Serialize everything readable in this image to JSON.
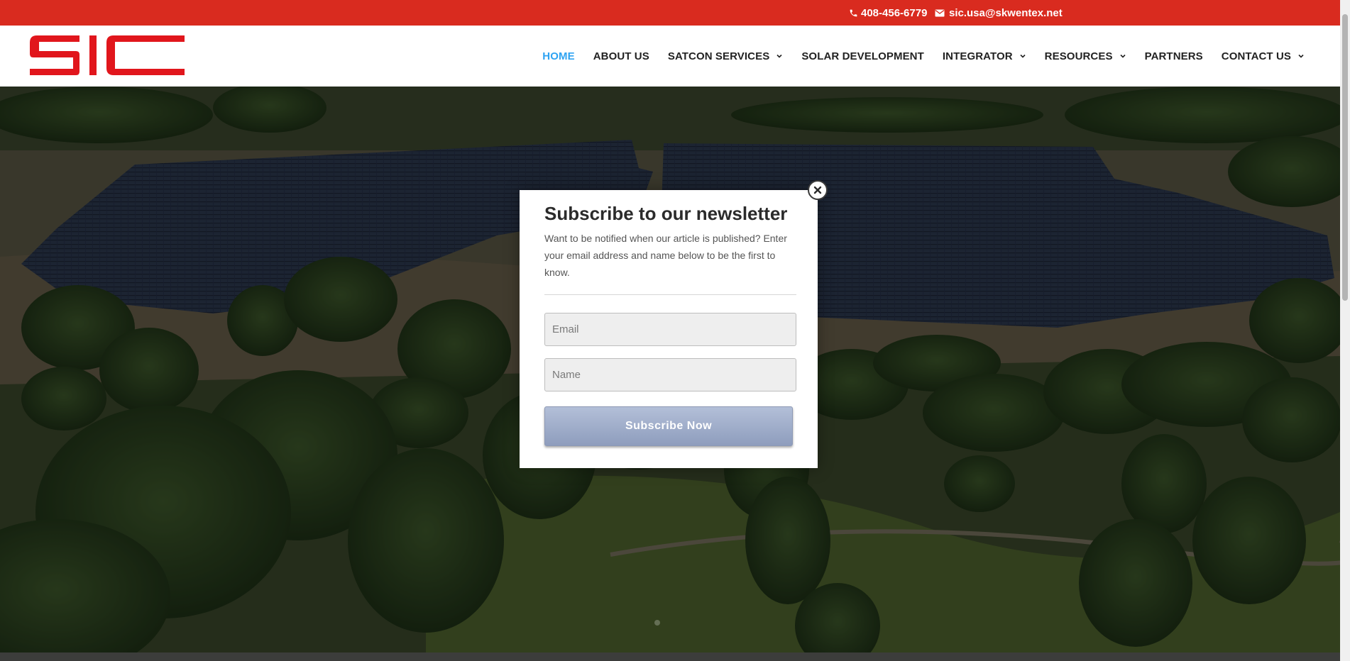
{
  "topbar": {
    "phone": "408-456-6779",
    "email": "sic.usa@skwentex.net",
    "phone_icon": "phone-icon",
    "email_icon": "envelope-icon",
    "background_color": "#d92b1f"
  },
  "header": {
    "logo_text": "SIC",
    "logo_color": "#e1161c",
    "nav": [
      {
        "label": "HOME",
        "active": true,
        "has_dropdown": false
      },
      {
        "label": "ABOUT US",
        "active": false,
        "has_dropdown": false
      },
      {
        "label": "SATCON SERVICES",
        "active": false,
        "has_dropdown": true
      },
      {
        "label": "SOLAR DEVELOPMENT",
        "active": false,
        "has_dropdown": false
      },
      {
        "label": "INTEGRATOR",
        "active": false,
        "has_dropdown": true
      },
      {
        "label": "RESOURCES",
        "active": false,
        "has_dropdown": true
      },
      {
        "label": "PARTNERS",
        "active": false,
        "has_dropdown": false
      },
      {
        "label": "CONTACT US",
        "active": false,
        "has_dropdown": true
      }
    ],
    "active_color": "#2ea3f2"
  },
  "modal": {
    "title": "Subscribe to our newsletter",
    "description": "Want to be notified when our article is published? Enter your email address and name below to be the first to know.",
    "email_placeholder": "Email",
    "name_placeholder": "Name",
    "button_label": "Subscribe Now",
    "close_icon": "close-icon"
  }
}
